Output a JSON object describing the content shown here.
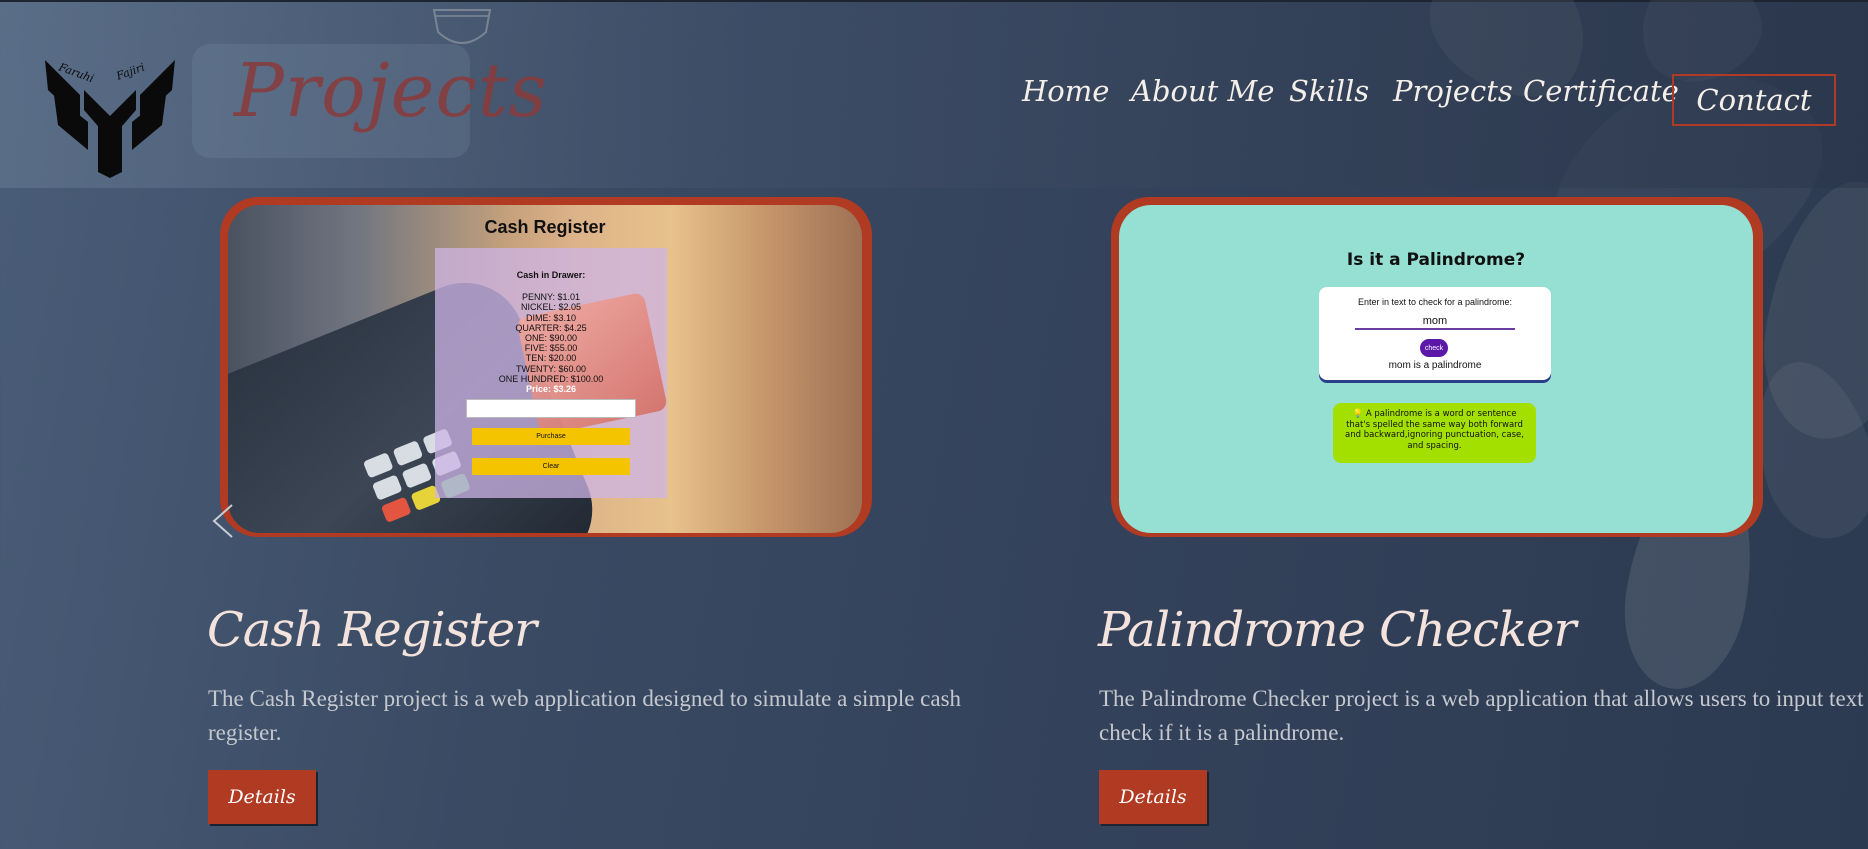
{
  "header": {
    "logo_text": "Faruhi Fajiri",
    "page_title": "Projects"
  },
  "nav": {
    "items": [
      {
        "label": "Home"
      },
      {
        "label": "About Me"
      },
      {
        "label": "Skills"
      },
      {
        "label": "Projects"
      },
      {
        "label": "Certificate"
      }
    ],
    "contact_label": "Contact"
  },
  "projects": [
    {
      "title": "Cash Register",
      "description": "The Cash Register project is a web application designed to simulate a simple cash register.",
      "details_label": "Details",
      "preview": {
        "heading": "Cash Register",
        "drawer_heading": "Cash in Drawer:",
        "drawer_lines": [
          "PENNY: $1.01",
          "NICKEL: $2.05",
          "DIME: $3.10",
          "QUARTER: $4.25",
          "ONE: $90.00",
          "FIVE: $55.00",
          "TEN: $20.00",
          "TWENTY: $60.00",
          "ONE HUNDRED: $100.00"
        ],
        "price_label": "Price:",
        "price_value": "$3.26",
        "purchase_label": "Purchase",
        "clear_label": "Clear"
      }
    },
    {
      "title": "Palindrome Checker",
      "description": "The Palindrome Checker project is a web application that allows users to input text and check if it is a palindrome.",
      "details_label": "Details",
      "preview": {
        "heading": "Is it a Palindrome?",
        "input_label": "Enter in text to check for a palindrome:",
        "input_value": "mom",
        "check_label": "check",
        "result": "mom is a palindrome",
        "info": "💡 A palindrome is a word or sentence that's spelled the same way both forward and backward,ignoring punctuation, case, and spacing."
      }
    }
  ],
  "colors": {
    "accent": "#b03a22",
    "background": "#33425a",
    "palindrome_bg": "#95e0d3",
    "info_box": "#a3e000",
    "cash_button": "#f5c400"
  }
}
